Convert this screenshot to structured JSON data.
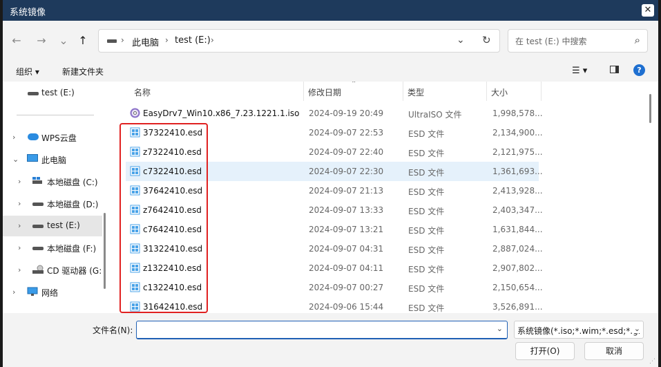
{
  "window": {
    "title": "系统镜像",
    "close": "✕"
  },
  "nav": {
    "back": "←",
    "forward": "→",
    "recent": "⌄",
    "up": "↑"
  },
  "address": {
    "crumb1": "此电脑",
    "crumb2": "test (E:)",
    "sep": "›",
    "refresh": "↻",
    "dropdown": "⌄"
  },
  "search": {
    "placeholder": "在 test (E:) 中搜索",
    "icon": "⌕"
  },
  "toolbar": {
    "organize": "组织 ▾",
    "new_folder": "新建文件夹",
    "view": "☰ ▾",
    "help": "?"
  },
  "sidebar": {
    "top": "test (E:)",
    "items": [
      {
        "label": "WPS云盘",
        "chev": "›",
        "icon": "cloud-icon"
      },
      {
        "label": "此电脑",
        "chev": "⌄",
        "icon": "computer-icon"
      },
      {
        "label": "本地磁盘 (C:)",
        "chev": "›",
        "icon": "windows-drive-icon"
      },
      {
        "label": "本地磁盘 (D:)",
        "chev": "›",
        "icon": "drive-icon"
      },
      {
        "label": "test (E:)",
        "chev": "›",
        "icon": "drive-icon"
      },
      {
        "label": "本地磁盘 (F:)",
        "chev": "›",
        "icon": "drive-icon"
      },
      {
        "label": "CD 驱动器 (G:",
        "chev": "›",
        "icon": "cd-drive-icon"
      },
      {
        "label": "网络",
        "chev": "›",
        "icon": "network-icon"
      }
    ]
  },
  "columns": {
    "name": "名称",
    "date": "修改日期",
    "type": "类型",
    "size": "大小",
    "sort": "⌃"
  },
  "files": [
    {
      "name": "EasyDrv7_Win10.x86_7.23.1221.1.iso",
      "date": "2024-09-19 20:49",
      "type": "UltraISO 文件",
      "size": "1,998,578...",
      "icon": "disc-icon"
    },
    {
      "name": "37322410.esd",
      "date": "2024-09-07 22:53",
      "type": "ESD 文件",
      "size": "2,134,900...",
      "icon": "windows-file-icon"
    },
    {
      "name": "z7322410.esd",
      "date": "2024-09-07 22:40",
      "type": "ESD 文件",
      "size": "2,121,975...",
      "icon": "windows-file-icon"
    },
    {
      "name": "c7322410.esd",
      "date": "2024-09-07 22:30",
      "type": "ESD 文件",
      "size": "1,361,693...",
      "icon": "windows-file-icon"
    },
    {
      "name": "37642410.esd",
      "date": "2024-09-07 21:13",
      "type": "ESD 文件",
      "size": "2,413,928...",
      "icon": "windows-file-icon"
    },
    {
      "name": "z7642410.esd",
      "date": "2024-09-07 13:33",
      "type": "ESD 文件",
      "size": "2,403,347...",
      "icon": "windows-file-icon"
    },
    {
      "name": "c7642410.esd",
      "date": "2024-09-07 13:21",
      "type": "ESD 文件",
      "size": "1,631,844...",
      "icon": "windows-file-icon"
    },
    {
      "name": "31322410.esd",
      "date": "2024-09-07 04:31",
      "type": "ESD 文件",
      "size": "2,887,024...",
      "icon": "windows-file-icon"
    },
    {
      "name": "z1322410.esd",
      "date": "2024-09-07 04:11",
      "type": "ESD 文件",
      "size": "2,907,802...",
      "icon": "windows-file-icon"
    },
    {
      "name": "c1322410.esd",
      "date": "2024-09-07 00:27",
      "type": "ESD 文件",
      "size": "2,150,654...",
      "icon": "windows-file-icon"
    },
    {
      "name": "31642410.esd",
      "date": "2024-09-06 15:44",
      "type": "ESD 文件",
      "size": "3,526,891...",
      "icon": "windows-file-icon"
    }
  ],
  "bottom": {
    "filename_label": "文件名(N):",
    "filename_value": "",
    "filetype": "系统镜像(*.iso;*.wim;*.esd;*.gl",
    "dropdown": "⌄",
    "open": "打开(O)",
    "cancel": "取消"
  },
  "colors": {
    "titlebar": "#1e3a5c",
    "selection": "#e5f1fb",
    "highlight_box": "#e02020",
    "accent": "#1e5fb4"
  }
}
